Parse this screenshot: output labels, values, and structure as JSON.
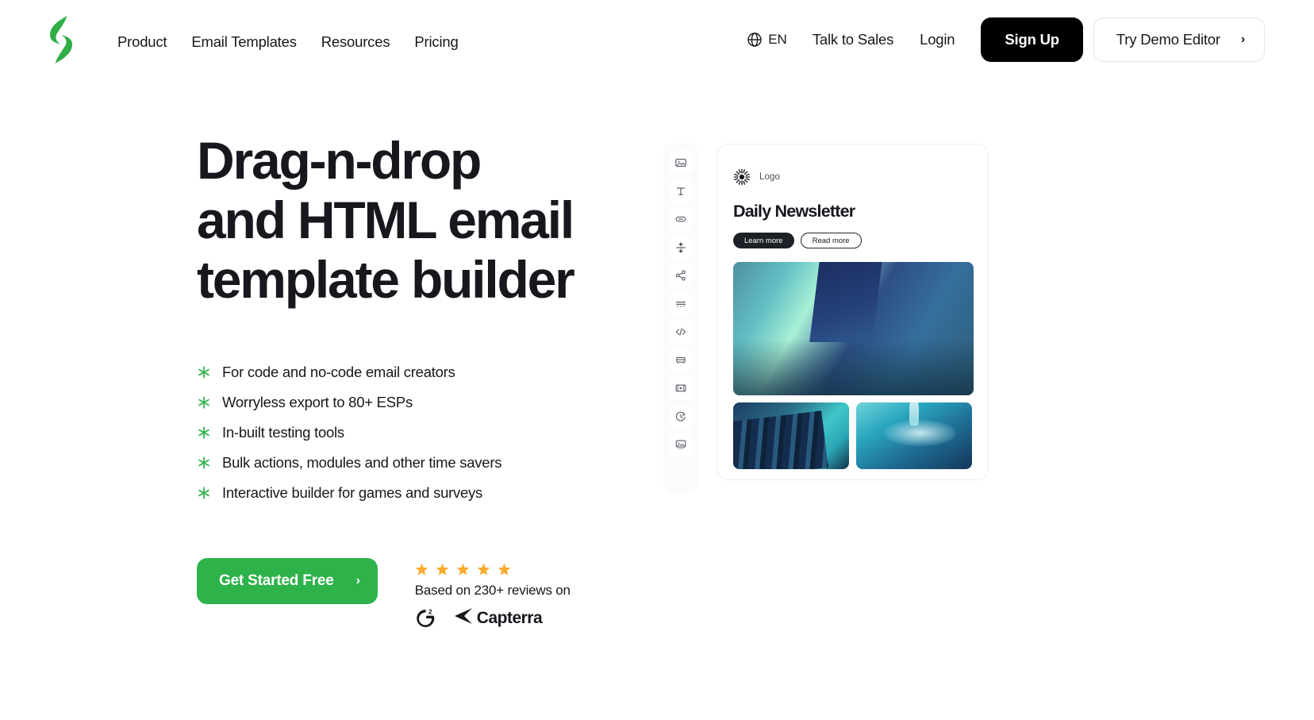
{
  "brand": {
    "logo_name": "stripo-logo",
    "green": "#2eb24a",
    "black": "#000000",
    "star_orange": "#f9ab2e"
  },
  "header": {
    "nav": [
      {
        "label": "Product"
      },
      {
        "label": "Email Templates"
      },
      {
        "label": "Resources"
      },
      {
        "label": "Pricing"
      }
    ],
    "language": {
      "icon": "globe-icon",
      "label": "EN"
    },
    "talk_to_sales": "Talk to Sales",
    "login": "Login",
    "sign_up": "Sign Up",
    "try_demo": "Try Demo Editor",
    "try_demo_chevron": "›"
  },
  "hero": {
    "headline_line1": "Drag-n-drop",
    "headline_line2": "and HTML email",
    "headline_line3": "template builder",
    "features": [
      "For code and no-code email creators",
      "Worryless export to 80+ ESPs",
      "In-built testing tools",
      "Bulk actions, modules and other time savers",
      "Interactive builder for games and surveys"
    ],
    "cta_label": "Get Started Free",
    "cta_chevron": "›",
    "reviews": {
      "star_count": 5,
      "text": "Based on 230+ reviews on",
      "badges": [
        {
          "name": "g2-badge",
          "label": "G2",
          "superscript": "2"
        },
        {
          "name": "capterra-badge",
          "label": "Capterra"
        }
      ]
    }
  },
  "editor": {
    "toolbar": [
      {
        "name": "image-tool",
        "icon": "image-icon"
      },
      {
        "name": "text-tool",
        "icon": "text-icon"
      },
      {
        "name": "button-tool",
        "icon": "button-icon"
      },
      {
        "name": "spacer-tool",
        "icon": "spacer-icon"
      },
      {
        "name": "social-tool",
        "icon": "share-icon"
      },
      {
        "name": "divider-tool",
        "icon": "divider-icon"
      },
      {
        "name": "html-tool",
        "icon": "code-icon"
      },
      {
        "name": "banner-tool",
        "icon": "banner-icon"
      },
      {
        "name": "video-tool",
        "icon": "video-icon"
      },
      {
        "name": "timer-tool",
        "icon": "timer-icon"
      },
      {
        "name": "carousel-tool",
        "icon": "carousel-icon"
      }
    ],
    "email": {
      "logo_icon": "sun-burst-icon",
      "logo_label": "Logo",
      "title": "Daily Newsletter",
      "buttons": [
        {
          "label": "Learn more",
          "style": "dark"
        },
        {
          "label": "Read more",
          "style": "outline"
        }
      ],
      "images": [
        {
          "name": "hero-image",
          "alt": "abstract blue teal architectural gradient"
        },
        {
          "name": "thumb-stairs",
          "alt": "abstract blue steps gradient"
        },
        {
          "name": "thumb-water",
          "alt": "abstract teal water ripple gradient"
        }
      ]
    }
  }
}
